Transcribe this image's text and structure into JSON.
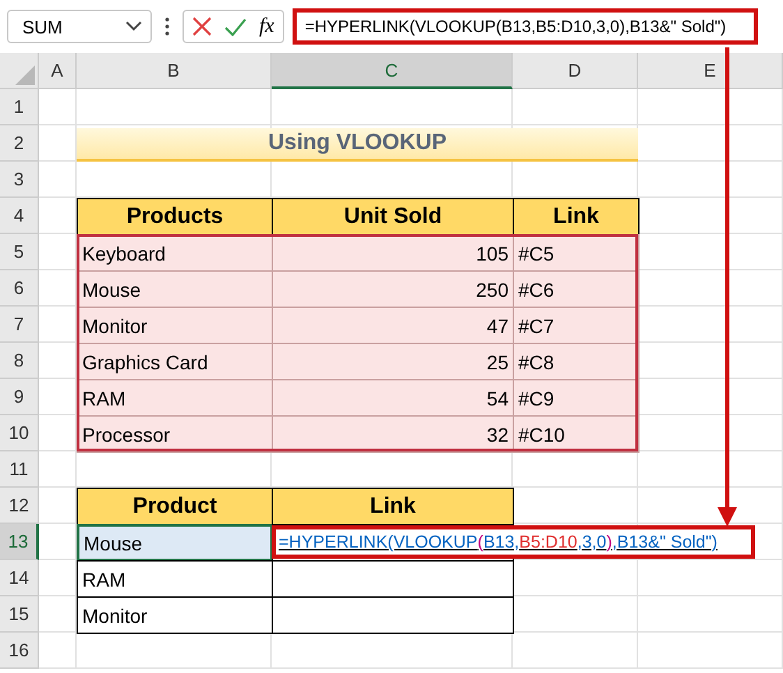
{
  "name_box": "SUM",
  "formula_bar": {
    "fx": "fx",
    "formula": "=HYPERLINK(VLOOKUP(B13,B5:D10,3,0),B13&\" Sold\")"
  },
  "columns": [
    {
      "label": "A",
      "selected": false
    },
    {
      "label": "B",
      "selected": false
    },
    {
      "label": "C",
      "selected": true
    },
    {
      "label": "D",
      "selected": false
    },
    {
      "label": "E",
      "selected": false
    }
  ],
  "rows": [
    {
      "label": "1",
      "selected": false
    },
    {
      "label": "2",
      "selected": false
    },
    {
      "label": "3",
      "selected": false
    },
    {
      "label": "4",
      "selected": false
    },
    {
      "label": "5",
      "selected": false
    },
    {
      "label": "6",
      "selected": false
    },
    {
      "label": "7",
      "selected": false
    },
    {
      "label": "8",
      "selected": false
    },
    {
      "label": "9",
      "selected": false
    },
    {
      "label": "10",
      "selected": false
    },
    {
      "label": "11",
      "selected": false
    },
    {
      "label": "12",
      "selected": false
    },
    {
      "label": "13",
      "selected": true
    },
    {
      "label": "14",
      "selected": false
    },
    {
      "label": "15",
      "selected": false
    },
    {
      "label": "16",
      "selected": false
    }
  ],
  "title": "Using VLOOKUP",
  "table1": {
    "headers": [
      "Products",
      "Unit Sold",
      "Link"
    ],
    "rows": [
      [
        "Keyboard",
        "105",
        "#C5"
      ],
      [
        "Mouse",
        "250",
        "#C6"
      ],
      [
        "Monitor",
        "47",
        "#C7"
      ],
      [
        "Graphics Card",
        "25",
        "#C8"
      ],
      [
        "RAM",
        "54",
        "#C9"
      ],
      [
        "Processor",
        "32",
        "#C10"
      ]
    ]
  },
  "table2": {
    "headers": [
      "Product",
      "Link"
    ],
    "rows": [
      {
        "product": "Mouse",
        "selected": true,
        "link_parts": [
          {
            "text": "=HYPERLINK(VLOOKUP",
            "color": "#0563c1"
          },
          {
            "text": "(",
            "color": "#c00080"
          },
          {
            "text": "B13,",
            "color": "#0563c1"
          },
          {
            "text": "B5:D10",
            "color": "#e03030"
          },
          {
            "text": ",3,0",
            "color": "#0563c1"
          },
          {
            "text": ")",
            "color": "#c00080"
          },
          {
            "text": ",B13&\" Sold\")",
            "color": "#0563c1"
          }
        ]
      },
      {
        "product": "RAM",
        "selected": false,
        "link_parts": []
      },
      {
        "product": "Monitor",
        "selected": false,
        "link_parts": []
      }
    ]
  }
}
